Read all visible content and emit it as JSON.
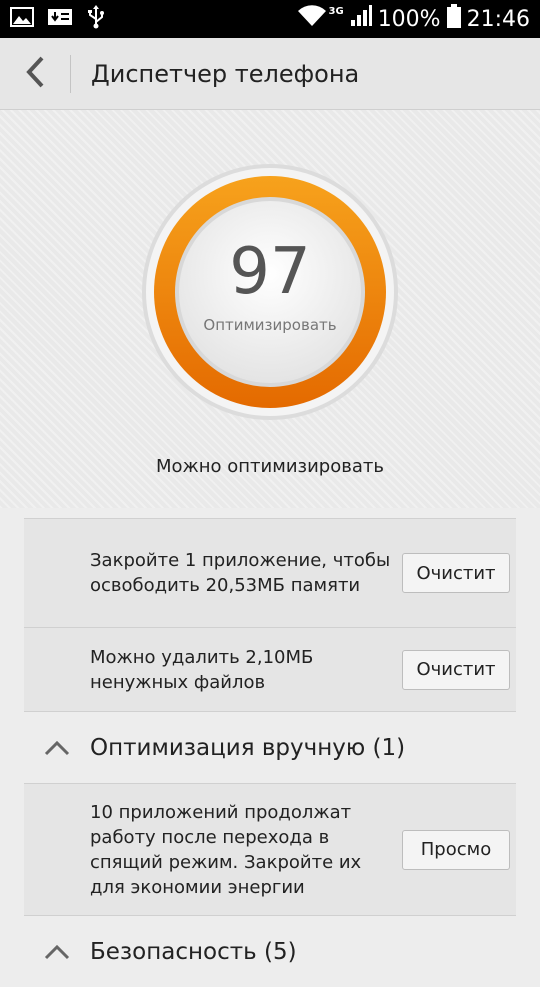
{
  "status_bar": {
    "network_label": "3G",
    "battery": "100%",
    "time": "21:46"
  },
  "header": {
    "title": "Диспетчер телефона"
  },
  "score": {
    "value": "97",
    "action_label": "Оптимизировать",
    "status_text": "Можно оптимизировать"
  },
  "items": [
    {
      "text": "Закройте 1 приложение, чтобы освободить 20,53МБ памяти",
      "button": "Очистит"
    },
    {
      "text": "Можно удалить 2,10МБ ненужных файлов",
      "button": "Очистит"
    }
  ],
  "sections": [
    {
      "title": "Оптимизация вручную (1)",
      "items": [
        {
          "text": "10 приложений продолжат работу после перехода в спящий режим. Закройте их для экономии энергии",
          "button": "Просмо"
        }
      ]
    },
    {
      "title": "Безопасность (5)"
    }
  ],
  "colors": {
    "ring_orange": "#f08a00",
    "ring_orange_dark": "#e06a00"
  },
  "icons": [
    "picture-icon",
    "download-icon",
    "usb-icon",
    "wifi-icon",
    "signal-icon",
    "battery-icon",
    "back-arrow-icon",
    "chevron-up-icon"
  ]
}
